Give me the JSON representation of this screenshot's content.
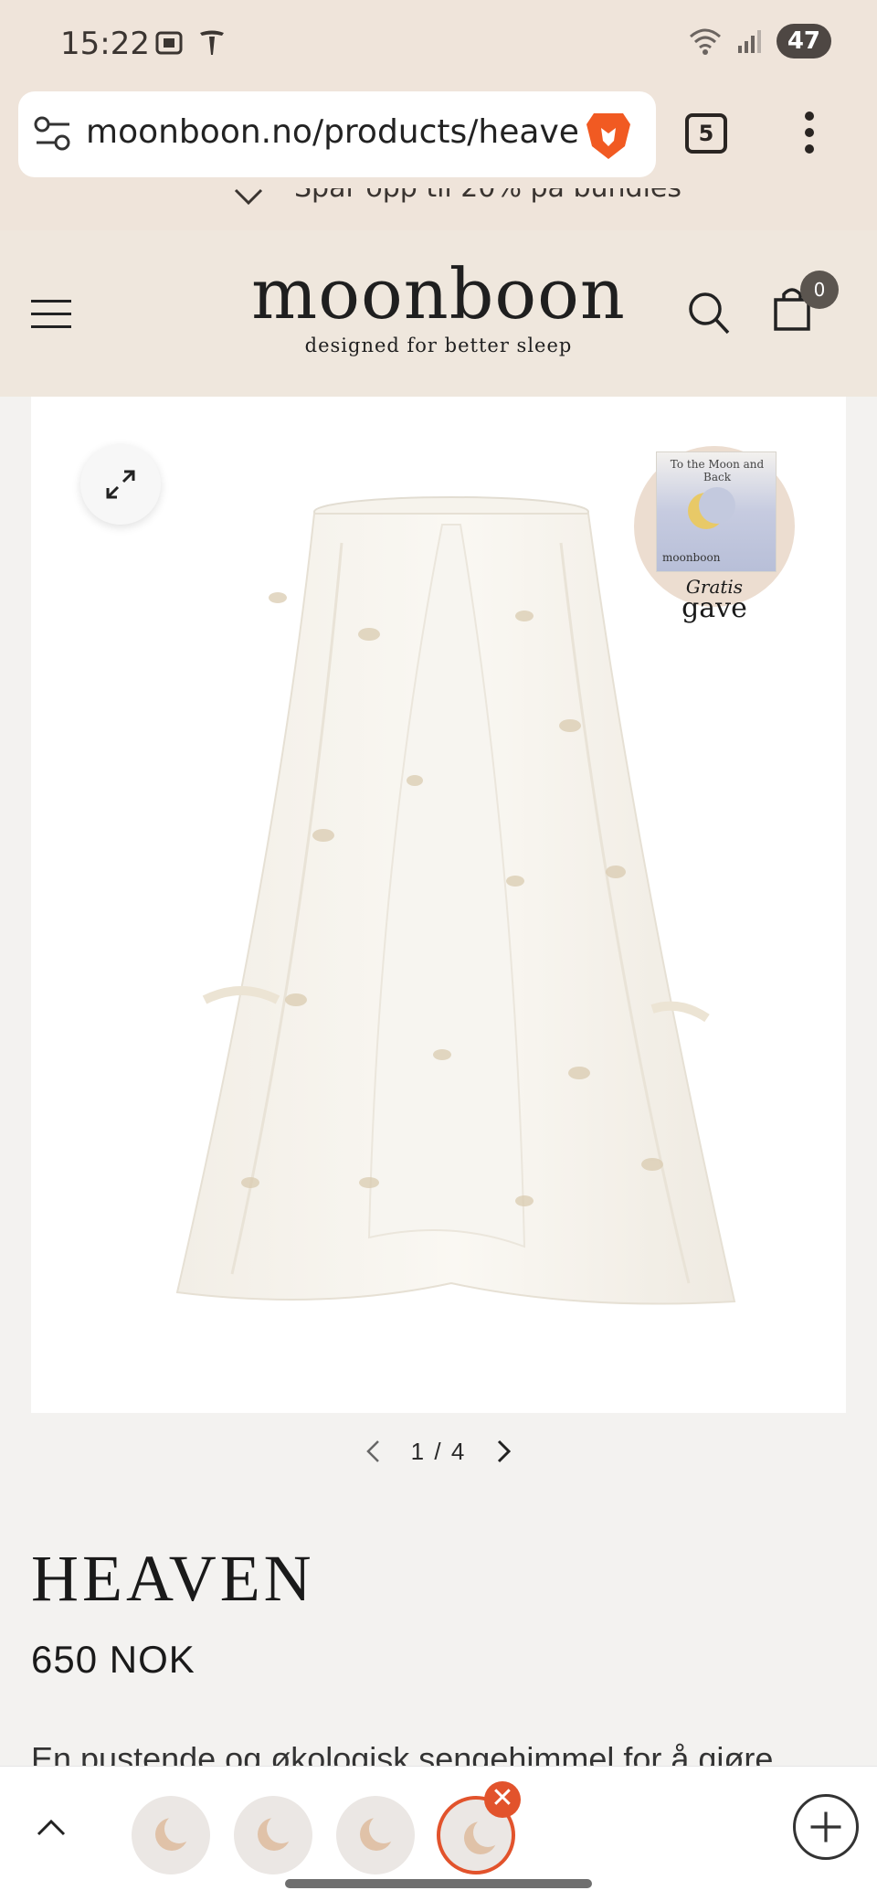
{
  "status_bar": {
    "time": "15:22",
    "battery": "47",
    "left_icons": [
      "screenshot-icon",
      "tesla-icon"
    ],
    "right_icons": [
      "wifi-icon",
      "signal-icon"
    ]
  },
  "browser": {
    "url": "moonboon.no/products/heaven",
    "tab_count": "5",
    "icons": [
      "tune-icon",
      "brave-lion-icon",
      "kebab-menu-icon"
    ]
  },
  "promo": {
    "text": "Spar opp til 20% på bundles"
  },
  "site_header": {
    "logo": "moonboon",
    "tagline": "designed for better sleep",
    "cart_count": "0"
  },
  "gift_badge": {
    "book_title": "To the Moon and Back",
    "book_brand": "moonboon",
    "label_line1": "Gratis",
    "label_line2": "gave"
  },
  "gallery": {
    "current": "1",
    "separator": "/",
    "total": "4"
  },
  "product": {
    "title": "HEAVEN",
    "price": "650 NOK",
    "description": "En pustende og økologisk sengehimmel for å gjøre"
  },
  "bottom_bar": {
    "tab_thumbnails": 4,
    "close_glyph": "✕",
    "accent": "#e2532c"
  },
  "colors": {
    "chrome_bg": "#efe4da",
    "header_bg": "#efe7dd",
    "page_bg": "#f3f2f0"
  }
}
